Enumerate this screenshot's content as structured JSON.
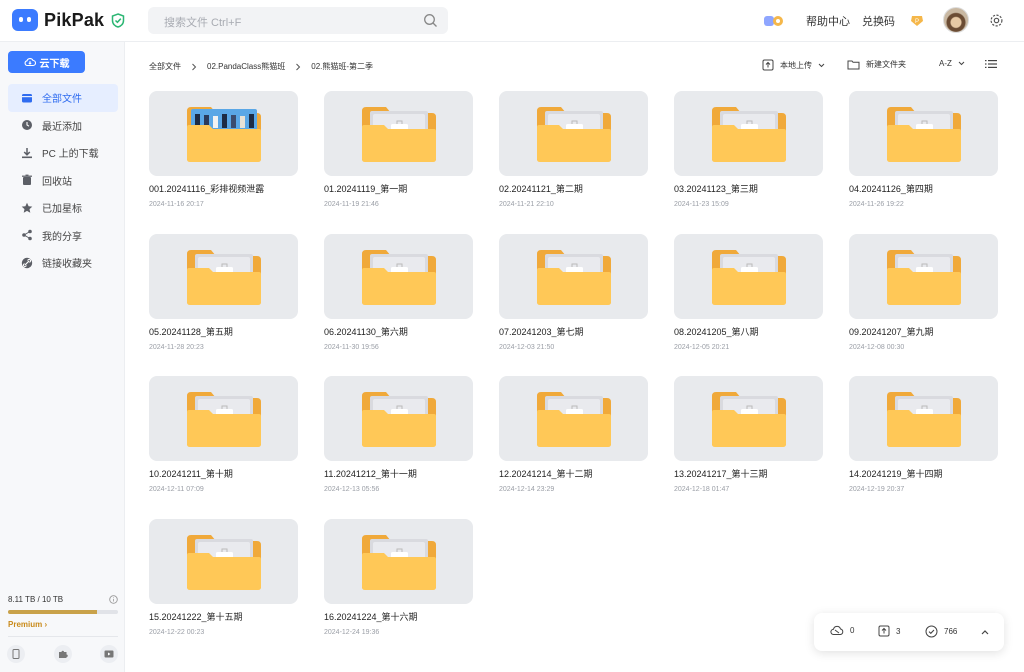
{
  "header": {
    "brand": "PikPak",
    "search_placeholder": "搜索文件 Ctrl+F",
    "help": "帮助中心",
    "redeem": "兑换码",
    "token_letter": "P"
  },
  "sidebar": {
    "cloud_download": "云下载",
    "items": [
      {
        "label": "全部文件",
        "icon": "folder-icon",
        "active": true
      },
      {
        "label": "最近添加",
        "icon": "clock-icon",
        "active": false
      },
      {
        "label": "PC 上的下载",
        "icon": "download-icon",
        "active": false
      },
      {
        "label": "回收站",
        "icon": "trash-icon",
        "active": false
      },
      {
        "label": "已加星标",
        "icon": "star-icon",
        "active": false
      },
      {
        "label": "我的分享",
        "icon": "share-icon",
        "active": false
      },
      {
        "label": "链接收藏夹",
        "icon": "link-icon",
        "active": false
      }
    ],
    "storage": {
      "text": "8.11 TB / 10 TB",
      "used_fraction": 0.811
    },
    "premium": "Premium"
  },
  "breadcrumb": [
    "全部文件",
    "02.PandaClass熊猫班",
    "02.熊猫班-第二季"
  ],
  "toolbar": {
    "upload": "本地上传",
    "new_folder": "新建文件夹",
    "sort": "A-Z"
  },
  "files": [
    {
      "name": "001.20241116_彩排视频泄露",
      "date": "2024-11-16 20:17",
      "has_preview": true
    },
    {
      "name": "01.20241119_第一期",
      "date": "2024-11-19 21:46"
    },
    {
      "name": "02.20241121_第二期",
      "date": "2024-11-21 22:10"
    },
    {
      "name": "03.20241123_第三期",
      "date": "2024-11-23 15:09"
    },
    {
      "name": "04.20241126_第四期",
      "date": "2024-11-26 19:22"
    },
    {
      "name": "05.20241128_第五期",
      "date": "2024-11-28 20:23"
    },
    {
      "name": "06.20241130_第六期",
      "date": "2024-11-30 19:56"
    },
    {
      "name": "07.20241203_第七期",
      "date": "2024-12-03 21:50"
    },
    {
      "name": "08.20241205_第八期",
      "date": "2024-12-05 20:21"
    },
    {
      "name": "09.20241207_第九期",
      "date": "2024-12-08 00:30"
    },
    {
      "name": "10.20241211_第十期",
      "date": "2024-12-11 07:09"
    },
    {
      "name": "11.20241212_第十一期",
      "date": "2024-12-13 05:56"
    },
    {
      "name": "12.20241214_第十二期",
      "date": "2024-12-14 23:29"
    },
    {
      "name": "13.20241217_第十三期",
      "date": "2024-12-18 01:47"
    },
    {
      "name": "14.20241219_第十四期",
      "date": "2024-12-19 20:37"
    },
    {
      "name": "15.20241222_第十五期",
      "date": "2024-12-22 00:23"
    },
    {
      "name": "16.20241224_第十六期",
      "date": "2024-12-24 19:36"
    }
  ],
  "transfer": {
    "downloads": "0",
    "uploads": "3",
    "completed": "766"
  },
  "colors": {
    "accent": "#3b7bff",
    "folder": "#ffc857",
    "folder_back": "#f0a93a"
  }
}
